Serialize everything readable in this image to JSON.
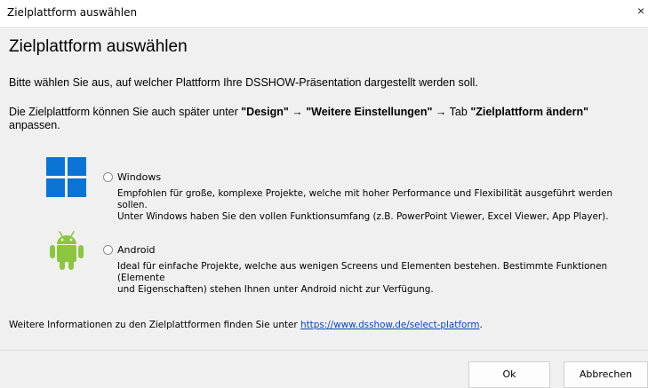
{
  "window": {
    "title": "Zielplattform auswählen",
    "close_glyph": "×"
  },
  "dialog": {
    "heading": "Zielplattform auswählen",
    "intro": "Bitte wählen Sie aus, auf welcher Plattform Ihre DSSHOW-Präsentation dargestellt werden soll.",
    "hint_prefix": "Die Zielplattform können Sie auch später unter ",
    "hint_design": "\"Design\"",
    "hint_arrow1": " → ",
    "hint_more": "\"Weitere Einstellungen\"",
    "hint_tab": " → Tab ",
    "hint_change": "\"Zielplattform ändern\"",
    "hint_suffix": "anpassen."
  },
  "options": [
    {
      "icon": "windows-logo-icon",
      "label": "Windows",
      "selected": false,
      "desc_line1": "Empfohlen für große, komplexe Projekte, welche mit hoher Performance und Flexibilität ausgeführt werden sollen.",
      "desc_line2": "Unter Windows haben Sie den vollen Funktionsumfang (z.B. PowerPoint Viewer, Excel Viewer, App Player)."
    },
    {
      "icon": "android-logo-icon",
      "label": "Android",
      "selected": false,
      "desc_line1": "Ideal für einfache Projekte, welche aus wenigen Screens und Elementen bestehen. Bestimmte Funktionen (Elemente",
      "desc_line2": "und Eigenschaften) stehen Ihnen unter Android nicht zur Verfügung."
    }
  ],
  "footer": {
    "text": "Weitere Informationen zu den Zielplattformen finden Sie unter ",
    "link": "https://www.dsshow.de/select-platform",
    "end": "."
  },
  "buttons": {
    "ok": "Ok",
    "cancel": "Abbrechen"
  },
  "colors": {
    "windows_blue": "#0a74d6",
    "android_green": "#8cc63f",
    "link": "#0645c8"
  }
}
